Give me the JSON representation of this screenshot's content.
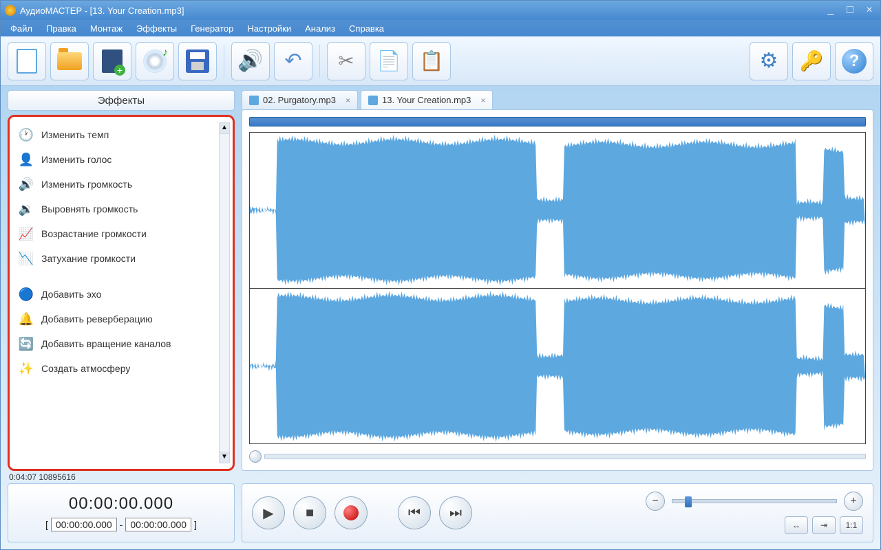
{
  "title": "АудиоМАСТЕР - [13. Your Creation.mp3]",
  "menu": [
    "Файл",
    "Правка",
    "Монтаж",
    "Эффекты",
    "Генератор",
    "Настройки",
    "Анализ",
    "Справка"
  ],
  "sidebar": {
    "title": "Эффекты",
    "groups": [
      [
        {
          "icon": "🕐",
          "label": "Изменить темп"
        },
        {
          "icon": "👤",
          "label": "Изменить голос"
        },
        {
          "icon": "🔊",
          "label": "Изменить громкость"
        },
        {
          "icon": "🔉",
          "label": "Выровнять громкость"
        },
        {
          "icon": "📈",
          "label": "Возрастание громкости"
        },
        {
          "icon": "📉",
          "label": "Затухание громкости"
        }
      ],
      [
        {
          "icon": "🔵",
          "label": "Добавить эхо"
        },
        {
          "icon": "🔔",
          "label": "Добавить реверберацию"
        },
        {
          "icon": "🔄",
          "label": "Добавить вращение каналов"
        },
        {
          "icon": "✨",
          "label": "Создать атмосферу"
        }
      ]
    ]
  },
  "tabs": [
    {
      "label": "02. Purgatory.mp3",
      "active": false
    },
    {
      "label": "13. Your Creation.mp3",
      "active": true
    }
  ],
  "status": "0:04:07 10895616",
  "time": {
    "current": "00:00:00.000",
    "range_start": "00:00:00.000",
    "range_end": "00:00:00.000"
  },
  "zoom_btns": [
    "↔",
    "⇥",
    "1:1"
  ]
}
